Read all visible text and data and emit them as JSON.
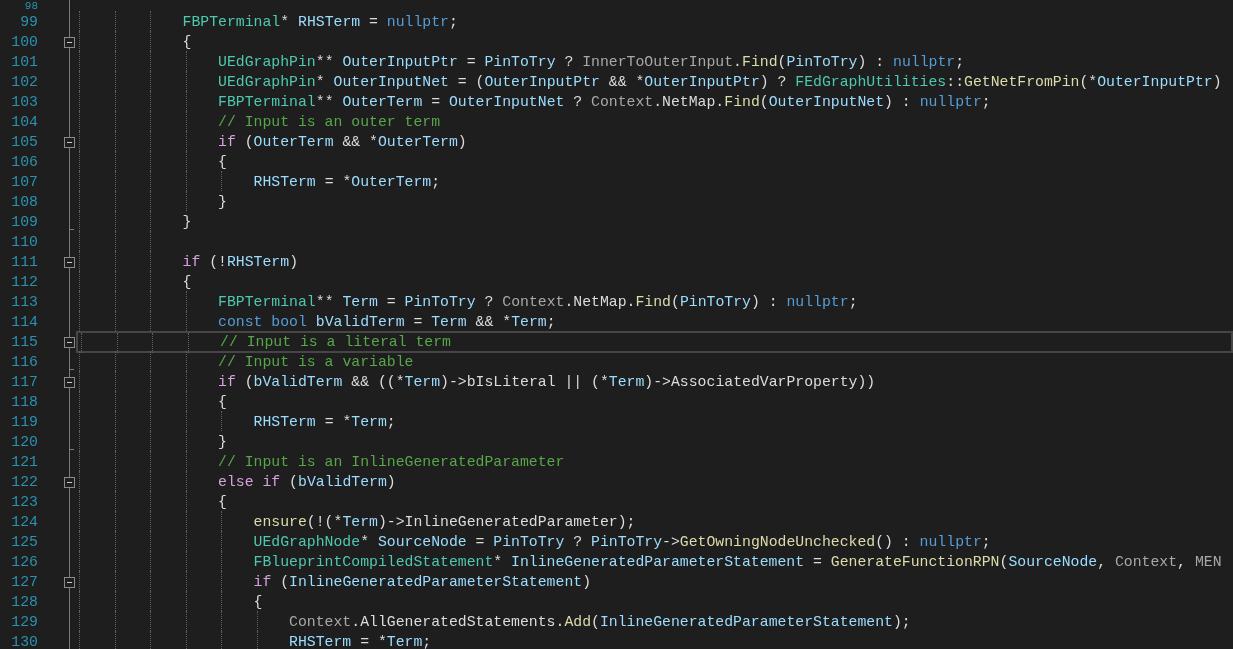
{
  "editor": {
    "lines": [
      {
        "number": "98",
        "collapsible": false,
        "block_end": false,
        "current": false
      },
      {
        "number": "99",
        "collapsible": false,
        "block_end": false,
        "current": false,
        "tokens": [
          {
            "kind": "type",
            "text": "FBPTerminal"
          },
          {
            "kind": "plain",
            "text": "* "
          },
          {
            "kind": "ident",
            "text": "RHSTerm"
          },
          {
            "kind": "plain",
            "text": " = "
          },
          {
            "kind": "keyword",
            "text": "nullptr"
          },
          {
            "kind": "plain",
            "text": ";"
          }
        ]
      },
      {
        "number": "100",
        "collapsible": true,
        "block_end": false,
        "current": false,
        "tokens": [
          {
            "kind": "plain",
            "text": "{"
          }
        ],
        "children": [
          {
            "number": "101",
            "collapsible": false,
            "block_end": false,
            "current": false,
            "tokens": [
              {
                "kind": "type",
                "text": "UEdGraphPin"
              },
              {
                "kind": "plain",
                "text": "** "
              },
              {
                "kind": "ident",
                "text": "OuterInputPtr"
              },
              {
                "kind": "plain",
                "text": " = "
              },
              {
                "kind": "ident",
                "text": "PinToTry"
              },
              {
                "kind": "plain",
                "text": " ? "
              },
              {
                "kind": "member",
                "text": "InnerToOuterInput"
              },
              {
                "kind": "plain",
                "text": "."
              },
              {
                "kind": "func",
                "text": "Find"
              },
              {
                "kind": "plain",
                "text": "("
              },
              {
                "kind": "ident",
                "text": "PinToTry"
              },
              {
                "kind": "plain",
                "text": ") : "
              },
              {
                "kind": "keyword",
                "text": "nullptr"
              },
              {
                "kind": "plain",
                "text": ";"
              }
            ]
          },
          {
            "number": "102",
            "collapsible": false,
            "block_end": false,
            "current": false,
            "tokens": [
              {
                "kind": "type",
                "text": "UEdGraphPin"
              },
              {
                "kind": "plain",
                "text": "* "
              },
              {
                "kind": "ident",
                "text": "OuterInputNet"
              },
              {
                "kind": "plain",
                "text": " = ("
              },
              {
                "kind": "ident",
                "text": "OuterInputPtr"
              },
              {
                "kind": "plain",
                "text": " && *"
              },
              {
                "kind": "ident",
                "text": "OuterInputPtr"
              },
              {
                "kind": "plain",
                "text": ") ? "
              },
              {
                "kind": "type",
                "text": "FEdGraphUtilities"
              },
              {
                "kind": "plain",
                "text": "::"
              },
              {
                "kind": "func",
                "text": "GetNetFromPin"
              },
              {
                "kind": "plain",
                "text": "(*"
              },
              {
                "kind": "ident",
                "text": "OuterInputPtr"
              },
              {
                "kind": "plain",
                "text": ")"
              }
            ]
          },
          {
            "number": "103",
            "collapsible": false,
            "block_end": false,
            "current": false,
            "tokens": [
              {
                "kind": "type",
                "text": "FBPTerminal"
              },
              {
                "kind": "plain",
                "text": "** "
              },
              {
                "kind": "ident",
                "text": "OuterTerm"
              },
              {
                "kind": "plain",
                "text": " = "
              },
              {
                "kind": "ident",
                "text": "OuterInputNet"
              },
              {
                "kind": "plain",
                "text": " ? "
              },
              {
                "kind": "member",
                "text": "Context"
              },
              {
                "kind": "plain",
                "text": ".NetMap."
              },
              {
                "kind": "func",
                "text": "Find"
              },
              {
                "kind": "plain",
                "text": "("
              },
              {
                "kind": "ident",
                "text": "OuterInputNet"
              },
              {
                "kind": "plain",
                "text": ") : "
              },
              {
                "kind": "keyword",
                "text": "nullptr"
              },
              {
                "kind": "plain",
                "text": ";"
              }
            ]
          },
          {
            "number": "104",
            "collapsible": false,
            "block_end": false,
            "current": false,
            "tokens": [
              {
                "kind": "comment",
                "text": "// Input is an outer term"
              }
            ]
          },
          {
            "number": "105",
            "collapsible": true,
            "block_end": false,
            "current": false,
            "tokens": [
              {
                "kind": "control",
                "text": "if"
              },
              {
                "kind": "plain",
                "text": " ("
              },
              {
                "kind": "ident",
                "text": "OuterTerm"
              },
              {
                "kind": "plain",
                "text": " && *"
              },
              {
                "kind": "ident",
                "text": "OuterTerm"
              },
              {
                "kind": "plain",
                "text": ")"
              }
            ]
          },
          {
            "number": "106",
            "collapsible": false,
            "block_end": false,
            "current": false,
            "tokens": [
              {
                "kind": "plain",
                "text": "{"
              }
            ],
            "children": [
              {
                "number": "107",
                "collapsible": false,
                "block_end": false,
                "current": false,
                "tokens": [
                  {
                    "kind": "ident",
                    "text": "RHSTerm"
                  },
                  {
                    "kind": "plain",
                    "text": " = *"
                  },
                  {
                    "kind": "ident",
                    "text": "OuterTerm"
                  },
                  {
                    "kind": "plain",
                    "text": ";"
                  }
                ]
              }
            ]
          },
          {
            "number": "108",
            "collapsible": false,
            "block_end": false,
            "current": false,
            "tokens": [
              {
                "kind": "plain",
                "text": "}"
              }
            ]
          }
        ]
      },
      {
        "number": "109",
        "collapsible": false,
        "block_end": true,
        "current": false,
        "tokens": [
          {
            "kind": "plain",
            "text": "}"
          }
        ]
      },
      {
        "number": "110",
        "collapsible": false,
        "block_end": false,
        "current": false
      },
      {
        "number": "111",
        "collapsible": true,
        "block_end": false,
        "current": false,
        "tokens": [
          {
            "kind": "control",
            "text": "if"
          },
          {
            "kind": "plain",
            "text": " (!"
          },
          {
            "kind": "ident",
            "text": "RHSTerm"
          },
          {
            "kind": "plain",
            "text": ")"
          }
        ]
      },
      {
        "number": "112",
        "collapsible": false,
        "block_end": false,
        "current": false,
        "tokens": [
          {
            "kind": "plain",
            "text": "{"
          }
        ],
        "children": [
          {
            "number": "113",
            "collapsible": false,
            "block_end": false,
            "current": false,
            "tokens": [
              {
                "kind": "type",
                "text": "FBPTerminal"
              },
              {
                "kind": "plain",
                "text": "** "
              },
              {
                "kind": "ident",
                "text": "Term"
              },
              {
                "kind": "plain",
                "text": " = "
              },
              {
                "kind": "ident",
                "text": "PinToTry"
              },
              {
                "kind": "plain",
                "text": " ? "
              },
              {
                "kind": "member",
                "text": "Context"
              },
              {
                "kind": "plain",
                "text": ".NetMap."
              },
              {
                "kind": "func",
                "text": "Find"
              },
              {
                "kind": "plain",
                "text": "("
              },
              {
                "kind": "ident",
                "text": "PinToTry"
              },
              {
                "kind": "plain",
                "text": ") : "
              },
              {
                "kind": "keyword",
                "text": "nullptr"
              },
              {
                "kind": "plain",
                "text": ";"
              }
            ]
          },
          {
            "number": "114",
            "collapsible": false,
            "block_end": false,
            "current": false,
            "tokens": [
              {
                "kind": "keyword",
                "text": "const"
              },
              {
                "kind": "keyword",
                "text": " bool"
              },
              {
                "kind": "ident",
                "text": " bValidTerm"
              },
              {
                "kind": "plain",
                "text": " = "
              },
              {
                "kind": "ident",
                "text": "Term"
              },
              {
                "kind": "plain",
                "text": " && *"
              },
              {
                "kind": "ident",
                "text": "Term"
              },
              {
                "kind": "plain",
                "text": ";"
              }
            ]
          },
          {
            "number": "115",
            "collapsible": true,
            "block_end": false,
            "current": true,
            "tokens": [
              {
                "kind": "comment",
                "text": "// Input is a literal term"
              }
            ]
          },
          {
            "number": "116",
            "collapsible": false,
            "block_end": true,
            "current": false,
            "tokens": [
              {
                "kind": "comment",
                "text": "// Input is a variable"
              }
            ]
          },
          {
            "number": "117",
            "collapsible": true,
            "block_end": false,
            "current": false,
            "tokens": [
              {
                "kind": "control",
                "text": "if"
              },
              {
                "kind": "plain",
                "text": " ("
              },
              {
                "kind": "ident",
                "text": "bValidTerm"
              },
              {
                "kind": "plain",
                "text": " && ((*"
              },
              {
                "kind": "ident",
                "text": "Term"
              },
              {
                "kind": "plain",
                "text": ")->bIsLiteral || (*"
              },
              {
                "kind": "ident",
                "text": "Term"
              },
              {
                "kind": "plain",
                "text": ")->AssociatedVarProperty))"
              }
            ]
          },
          {
            "number": "118",
            "collapsible": false,
            "block_end": false,
            "current": false,
            "tokens": [
              {
                "kind": "plain",
                "text": "{"
              }
            ],
            "children": [
              {
                "number": "119",
                "collapsible": false,
                "block_end": false,
                "current": false,
                "tokens": [
                  {
                    "kind": "ident",
                    "text": "RHSTerm"
                  },
                  {
                    "kind": "plain",
                    "text": " = *"
                  },
                  {
                    "kind": "ident",
                    "text": "Term"
                  },
                  {
                    "kind": "plain",
                    "text": ";"
                  }
                ]
              }
            ]
          },
          {
            "number": "120",
            "collapsible": false,
            "block_end": true,
            "current": false,
            "tokens": [
              {
                "kind": "plain",
                "text": "}"
              }
            ]
          },
          {
            "number": "121",
            "collapsible": false,
            "block_end": false,
            "current": false,
            "tokens": [
              {
                "kind": "comment",
                "text": "// Input is an InlineGeneratedParameter"
              }
            ]
          },
          {
            "number": "122",
            "collapsible": true,
            "block_end": false,
            "current": false,
            "tokens": [
              {
                "kind": "control",
                "text": "else"
              },
              {
                "kind": "control",
                "text": " if"
              },
              {
                "kind": "plain",
                "text": " ("
              },
              {
                "kind": "ident",
                "text": "bValidTerm"
              },
              {
                "kind": "plain",
                "text": ")"
              }
            ]
          },
          {
            "number": "123",
            "collapsible": false,
            "block_end": false,
            "current": false,
            "tokens": [
              {
                "kind": "plain",
                "text": "{"
              }
            ],
            "children": [
              {
                "number": "124",
                "collapsible": false,
                "block_end": false,
                "current": false,
                "tokens": [
                  {
                    "kind": "func",
                    "text": "ensure"
                  },
                  {
                    "kind": "plain",
                    "text": "(!(*"
                  },
                  {
                    "kind": "ident",
                    "text": "Term"
                  },
                  {
                    "kind": "plain",
                    "text": ")->InlineGeneratedParameter);"
                  }
                ]
              },
              {
                "number": "125",
                "collapsible": false,
                "block_end": false,
                "current": false,
                "tokens": [
                  {
                    "kind": "type",
                    "text": "UEdGraphNode"
                  },
                  {
                    "kind": "plain",
                    "text": "* "
                  },
                  {
                    "kind": "ident",
                    "text": "SourceNode"
                  },
                  {
                    "kind": "plain",
                    "text": " = "
                  },
                  {
                    "kind": "ident",
                    "text": "PinToTry"
                  },
                  {
                    "kind": "plain",
                    "text": " ? "
                  },
                  {
                    "kind": "ident",
                    "text": "PinToTry"
                  },
                  {
                    "kind": "plain",
                    "text": "->"
                  },
                  {
                    "kind": "func",
                    "text": "GetOwningNodeUnchecked"
                  },
                  {
                    "kind": "plain",
                    "text": "() : "
                  },
                  {
                    "kind": "keyword",
                    "text": "nullptr"
                  },
                  {
                    "kind": "plain",
                    "text": ";"
                  }
                ]
              },
              {
                "number": "126",
                "collapsible": false,
                "block_end": false,
                "current": false,
                "tokens": [
                  {
                    "kind": "type",
                    "text": "FBlueprintCompiledStatement"
                  },
                  {
                    "kind": "plain",
                    "text": "* "
                  },
                  {
                    "kind": "ident",
                    "text": "InlineGeneratedParameterStatement"
                  },
                  {
                    "kind": "plain",
                    "text": " = "
                  },
                  {
                    "kind": "func",
                    "text": "GenerateFunctionRPN"
                  },
                  {
                    "kind": "plain",
                    "text": "("
                  },
                  {
                    "kind": "ident",
                    "text": "SourceNode"
                  },
                  {
                    "kind": "plain",
                    "text": ", "
                  },
                  {
                    "kind": "member",
                    "text": "Context"
                  },
                  {
                    "kind": "plain",
                    "text": ", "
                  },
                  {
                    "kind": "member",
                    "text": "MEN"
                  }
                ]
              },
              {
                "number": "127",
                "collapsible": true,
                "block_end": false,
                "current": false,
                "tokens": [
                  {
                    "kind": "control",
                    "text": "if"
                  },
                  {
                    "kind": "plain",
                    "text": " ("
                  },
                  {
                    "kind": "ident",
                    "text": "InlineGeneratedParameterStatement"
                  },
                  {
                    "kind": "plain",
                    "text": ")"
                  }
                ]
              },
              {
                "number": "128",
                "collapsible": false,
                "block_end": false,
                "current": false,
                "tokens": [
                  {
                    "kind": "plain",
                    "text": "{"
                  }
                ],
                "children": [
                  {
                    "number": "129",
                    "collapsible": false,
                    "block_end": false,
                    "current": false,
                    "tokens": [
                      {
                        "kind": "member",
                        "text": "Context"
                      },
                      {
                        "kind": "plain",
                        "text": ".AllGeneratedStatements."
                      },
                      {
                        "kind": "func",
                        "text": "Add"
                      },
                      {
                        "kind": "plain",
                        "text": "("
                      },
                      {
                        "kind": "ident",
                        "text": "InlineGeneratedParameterStatement"
                      },
                      {
                        "kind": "plain",
                        "text": ");"
                      }
                    ]
                  },
                  {
                    "number": "130",
                    "collapsible": false,
                    "block_end": false,
                    "current": false,
                    "tokens": [
                      {
                        "kind": "ident",
                        "text": "RHSTerm"
                      },
                      {
                        "kind": "plain",
                        "text": " = *"
                      },
                      {
                        "kind": "ident",
                        "text": "Term"
                      },
                      {
                        "kind": "plain",
                        "text": ";"
                      }
                    ]
                  }
                ]
              }
            ]
          }
        ]
      }
    ]
  }
}
